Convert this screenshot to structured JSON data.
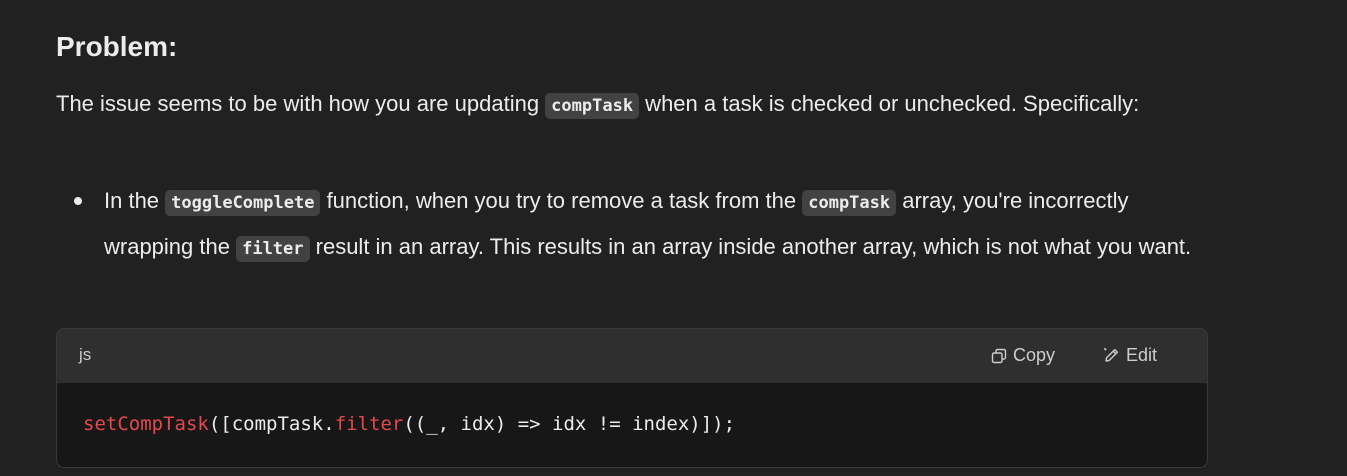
{
  "heading": "Problem:",
  "paragraph": {
    "text_before": "The issue seems to be with how you are updating ",
    "code": "compTask",
    "text_after": " when a task is checked or unchecked. Specifically:"
  },
  "bullets": [
    {
      "part1": "In the ",
      "code1": "toggleComplete",
      "part2": " function, when you try to remove a task from the ",
      "code2": "compTask",
      "part3": " array, you're incorrectly wrapping the ",
      "code3": "filter",
      "part4": " result in an array. This results in an array inside another array, which is not what you want."
    }
  ],
  "codeblock": {
    "language": "js",
    "copy_label": "Copy",
    "edit_label": "Edit",
    "copy_icon": "copy-icon",
    "edit_icon": "edit-icon",
    "tokens": {
      "fn_name": "setCompTask",
      "arg_open": "([compTask.",
      "method": "filter",
      "rest": "((_, idx) => idx != index)]);"
    }
  },
  "colors": {
    "background": "#212121",
    "code_header": "#2f2f2f",
    "code_body": "#171717",
    "inline_code_bg": "#424242",
    "function_token": "#e5484d"
  }
}
